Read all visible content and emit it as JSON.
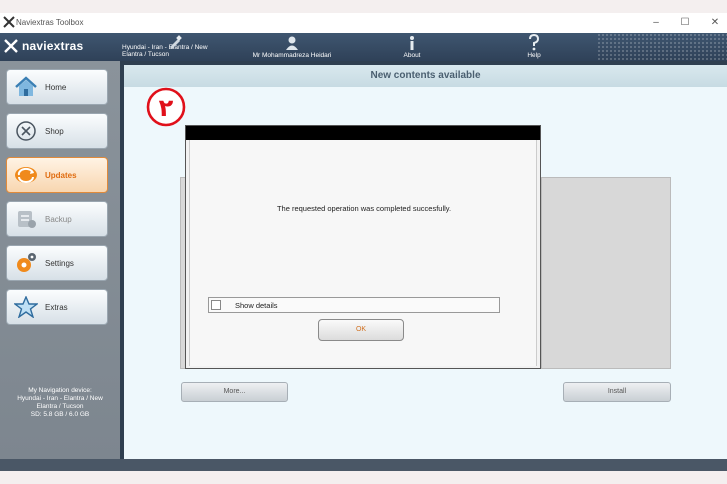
{
  "window": {
    "title": "Naviextras Toolbox",
    "controls": {
      "minimize": "–",
      "maximize": "☐",
      "close": "✕"
    }
  },
  "header": {
    "logo_text": "naviextras",
    "device_line1": "Hyundai - Iran - Elantra / New",
    "device_line2": "Elantra / Tucson",
    "user": "Mr Mohammadreza Heidari",
    "about": "About",
    "help": "Help"
  },
  "sidebar": {
    "items": [
      {
        "label": "Home",
        "icon": "house-icon"
      },
      {
        "label": "Shop",
        "icon": "shop-icon"
      },
      {
        "label": "Updates",
        "icon": "updates-icon"
      },
      {
        "label": "Backup",
        "icon": "backup-icon"
      },
      {
        "label": "Settings",
        "icon": "gear-icon"
      },
      {
        "label": "Extras",
        "icon": "star-icon"
      }
    ],
    "active": "Updates",
    "device_info": {
      "line1": "My Navigation device:",
      "line2": "Hyundai - Iran - Elantra / New",
      "line3": "Elantra / Tucson",
      "line4": "SD: 5.8 GB / 6.0 GB"
    }
  },
  "content": {
    "title": "New contents available",
    "more_button": "More...",
    "install_button": "Install",
    "badge_text": "۲"
  },
  "dialog": {
    "message": "The requested operation was completed succesfully.",
    "show_details": "Show details",
    "ok": "OK"
  },
  "colors": {
    "header": "#34495e",
    "active_accent": "#e06c10",
    "badge": "#e0101a"
  }
}
